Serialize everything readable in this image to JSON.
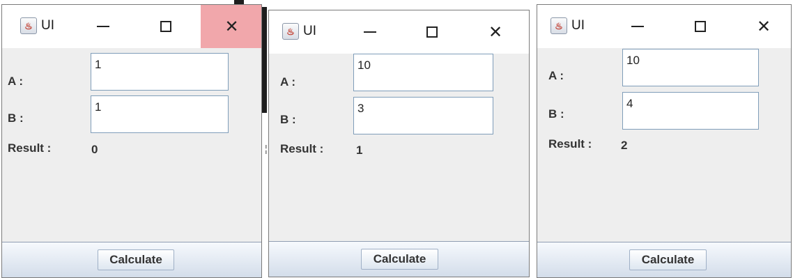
{
  "windows": [
    {
      "title": "UI",
      "icon": "java-cup-icon",
      "controls": {
        "minimize": "—",
        "maximize": "☐",
        "close": "✕"
      },
      "close_hovered": true,
      "label_a": "A :",
      "label_b": "B :",
      "label_result": "Result :",
      "value_a": "1",
      "value_b": "1",
      "result": "0",
      "button": "Calculate"
    },
    {
      "title": "UI",
      "icon": "java-cup-icon",
      "controls": {
        "minimize": "—",
        "maximize": "☐",
        "close": "✕"
      },
      "close_hovered": false,
      "label_a": "A :",
      "label_b": "B :",
      "label_result": "Result :",
      "value_a": "10",
      "value_b": "3",
      "result": "1",
      "button": "Calculate"
    },
    {
      "title": "UI",
      "icon": "java-cup-icon",
      "controls": {
        "minimize": "—",
        "maximize": "☐",
        "close": "✕"
      },
      "close_hovered": false,
      "label_a": "A :",
      "label_b": "B :",
      "label_result": "Result :",
      "value_a": "10",
      "value_b": "4",
      "result": "2",
      "button": "Calculate"
    }
  ],
  "colors": {
    "close_hover": "#f1a7ab",
    "client_area": "#eeeeee",
    "field_border": "#7f9db9"
  }
}
